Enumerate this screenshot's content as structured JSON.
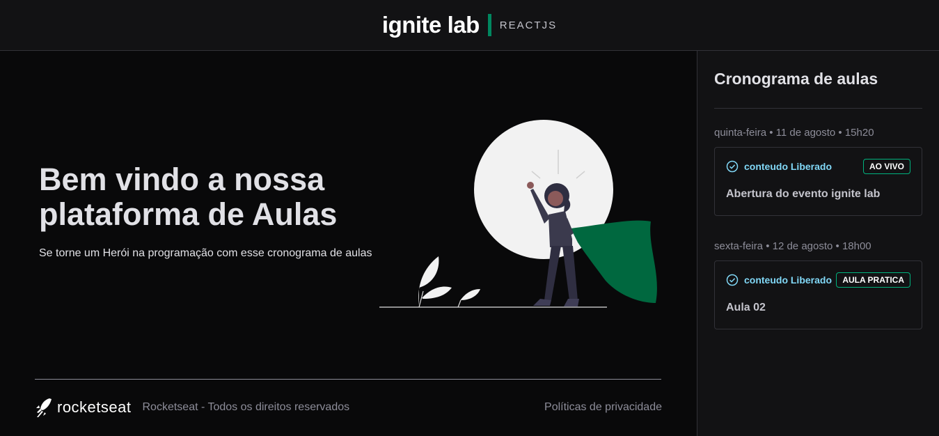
{
  "header": {
    "logo": "ignite lab",
    "subtitle": "REACTJS"
  },
  "hero": {
    "title": "Bem vindo a nossa plataforma de Aulas",
    "subtitle": "Se torne um Herói na programação com esse cronograma de aulas"
  },
  "footer": {
    "brand": "rocketseat",
    "copyright": "Rocketseat - Todos os direitos reservados",
    "privacy": "Políticas de privacidade"
  },
  "sidebar": {
    "title": "Cronograma de aulas",
    "lessons": [
      {
        "date": "quinta-feira • 11 de agosto • 15h20",
        "status": "conteudo Liberado",
        "badge": "AO VIVO",
        "title": "Abertura do evento ignite lab"
      },
      {
        "date": "sexta-feira • 12 de agosto • 18h00",
        "status": "conteudo Liberado",
        "badge": "AULA PRATICA",
        "title": "Aula 02"
      }
    ]
  },
  "icons": {
    "check": "check-circle-icon",
    "rocket": "rocketseat-logo-icon"
  },
  "colors": {
    "accent": "#00875f",
    "badge_border": "#00b37e",
    "status": "#81d8f7",
    "cape": "#00875f"
  }
}
